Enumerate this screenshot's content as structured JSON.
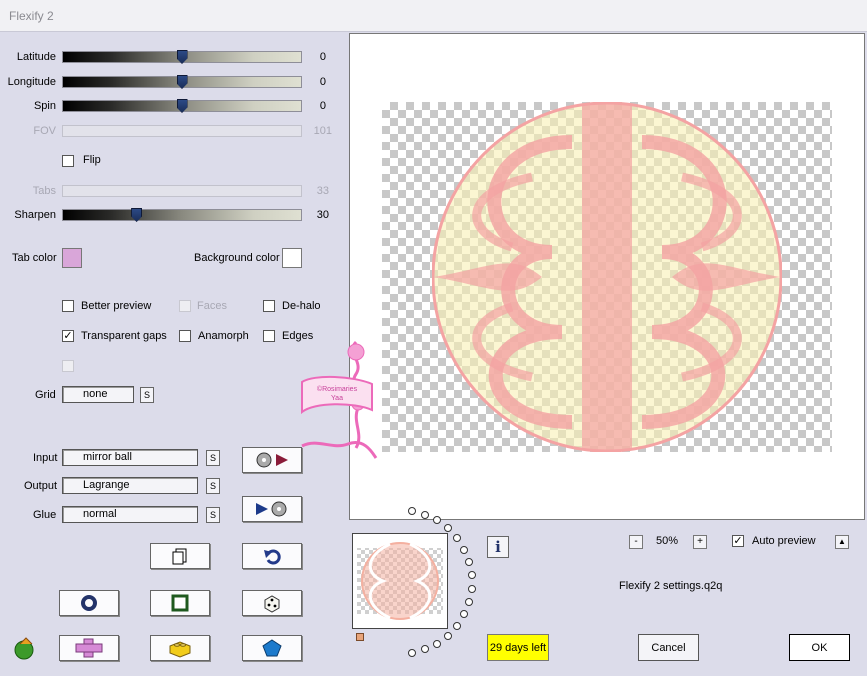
{
  "window": {
    "title": "Flexify 2"
  },
  "sliders": [
    {
      "label": "Latitude",
      "value": "0",
      "fraction": 0.5,
      "enabled": true
    },
    {
      "label": "Longitude",
      "value": "0",
      "fraction": 0.5,
      "enabled": true
    },
    {
      "label": "Spin",
      "value": "0",
      "fraction": 0.5,
      "enabled": true
    },
    {
      "label": "FOV",
      "value": "101",
      "fraction": null,
      "enabled": false
    },
    {
      "label": "Tabs",
      "value": "33",
      "fraction": null,
      "enabled": false
    },
    {
      "label": "Sharpen",
      "value": "30",
      "fraction": 0.3,
      "enabled": true
    }
  ],
  "flip": {
    "label": "Flip",
    "checked": false
  },
  "tab_color": {
    "label": "Tab color",
    "color": "#d9a6d9"
  },
  "background_color": {
    "label": "Background color",
    "color": "#ffffff"
  },
  "options": {
    "better_preview": {
      "label": "Better preview",
      "checked": false
    },
    "faces": {
      "label": "Faces",
      "checked": false
    },
    "de_halo": {
      "label": "De-halo",
      "checked": false
    },
    "transparent_gaps": {
      "label": "Transparent gaps",
      "checked": true
    },
    "anamorph": {
      "label": "Anamorph",
      "checked": false
    },
    "edges": {
      "label": "Edges",
      "checked": false
    }
  },
  "grid": {
    "label": "Grid",
    "value": "none",
    "s_label": "S"
  },
  "input": {
    "label": "Input",
    "value": "mirror ball",
    "s_label": "S"
  },
  "output": {
    "label": "Output",
    "value": "Lagrange",
    "s_label": "S"
  },
  "glue": {
    "label": "Glue",
    "value": "normal",
    "s_label": "S"
  },
  "watermark": {
    "text": "©Rosimaries\nYaa"
  },
  "zoom": {
    "minus": "-",
    "value": "50%",
    "plus": "+"
  },
  "auto_preview": {
    "label": "Auto preview",
    "checked": true,
    "arrow": "▲"
  },
  "settings_file": "Flexify 2 settings.q2q",
  "trial": "29 days left",
  "info_label": "i",
  "cancel_label": "Cancel",
  "ok_label": "OK",
  "colors": {
    "accent_pink": "#f4a3a3",
    "accent_yellow": "#f8f0b4",
    "trial_yellow": "#ffff00"
  }
}
